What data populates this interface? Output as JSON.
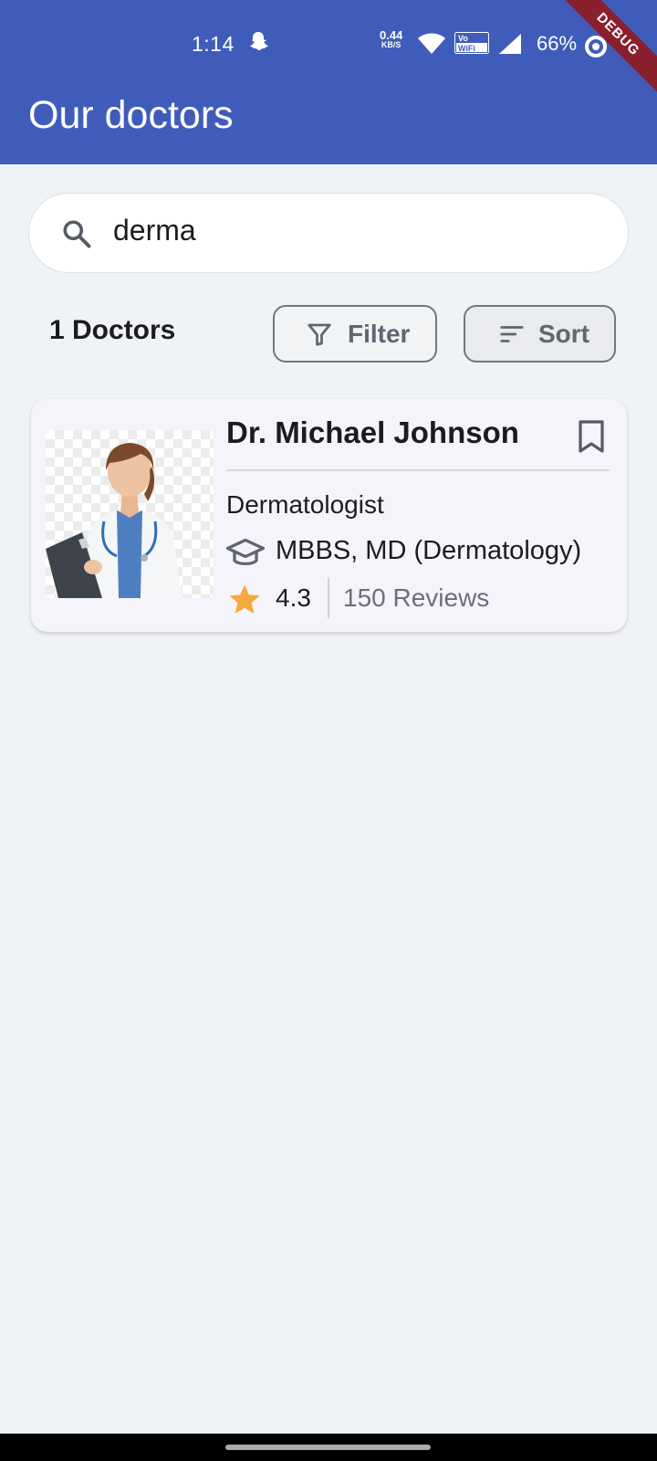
{
  "status_bar": {
    "time": "1:14",
    "net_speed_value": "0.44",
    "net_speed_unit": "KB/S",
    "volte_label": "Vo WiFi",
    "battery": "66%"
  },
  "debug_banner": "DEBUG",
  "app_bar": {
    "title": "Our doctors"
  },
  "search": {
    "value": "derma",
    "icon": "search-icon"
  },
  "results": {
    "count_label": "1 Doctors"
  },
  "toolbar": {
    "filter_label": "Filter",
    "sort_label": "Sort"
  },
  "doctors": [
    {
      "name": "Dr. Michael Johnson",
      "specialty": "Dermatologist",
      "degree": "MBBS, MD (Dermatology)",
      "rating": "4.3",
      "reviews": "150 Reviews"
    }
  ],
  "colors": {
    "app_bar": "#405cbb",
    "background": "#f0f3f5",
    "star": "#f6a93b",
    "debug": "#8a1f2e"
  }
}
